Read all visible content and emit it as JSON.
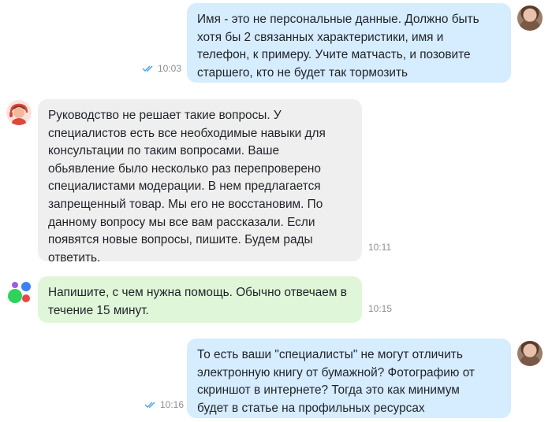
{
  "messages": [
    {
      "text": "Имя - это не персональные данные. Должно быть\nхотя бы 2 связанных характеристики, имя и\nтелефон, к примеру. Учите матчасть, и позовите\nстаршего, кто не будет так тормозить",
      "time": "10:03",
      "read": true
    },
    {
      "text": "Руководство не решает такие вопросы. У\nспециалистов есть все необходимые навыки для\nконсультации по таким вопросами. Ваше\nобьявление было несколько раз перепроверено\nспециалистами модерации. В нем  предлагается\nзапрещенный товар. Мы его не восстановим. По\nданному вопросу мы все вам рассказали. Если\nпоявятся новые вопросы, пишите. Будем рады\nответить.",
      "time": "10:11"
    },
    {
      "text": "Напишите, с чем нужна помощь. Обычно отвечаем в\nтечение 15 минут.",
      "time": "10:15"
    },
    {
      "text": "То есть ваши \"специалисты\" не могут отличить\nэлектронную книгу от бумажной? Фотографию от\nскриншот в интернете? Тогда это как минимум\nбудет в статье на профильных ресурсах",
      "time": "10:16",
      "read": true
    }
  ],
  "colors": {
    "outgoing_bubble": "#d6ecff",
    "incoming_bubble": "#efefef",
    "auto_reply_bubble": "#dff6d8",
    "read_ticks": "#4aa3f0"
  }
}
